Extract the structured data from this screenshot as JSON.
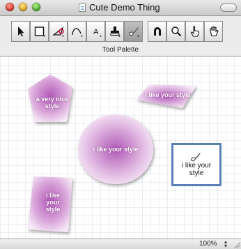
{
  "window": {
    "title": "Cute Demo Thing"
  },
  "toolbar": {
    "tools": [
      {
        "icon": "arrow-pointer-icon"
      },
      {
        "icon": "rectangle-icon"
      },
      {
        "icon": "polygon-icon"
      },
      {
        "icon": "curve-icon"
      },
      {
        "icon": "text-tool-icon",
        "glyph": "A"
      },
      {
        "icon": "stamp-icon"
      },
      {
        "icon": "style-brush-icon",
        "selected": true
      },
      {
        "icon": "magnet-icon"
      },
      {
        "icon": "zoom-icon"
      },
      {
        "icon": "pointing-hand-icon"
      },
      {
        "icon": "grab-hand-icon"
      }
    ],
    "palette_label": "Tool Palette"
  },
  "canvas": {
    "shapes": [
      {
        "label": "a very nice style"
      },
      {
        "label": "i like your style"
      },
      {
        "label": "i like your style"
      },
      {
        "label": "i like your style"
      }
    ],
    "selected_box": {
      "label": "i like your style"
    }
  },
  "colors": {
    "shape_fill_dark": "#b15ab6",
    "shape_fill_light": "#f6e8f6",
    "selection_border": "#5b7fb8"
  },
  "status": {
    "zoom": "100%"
  }
}
